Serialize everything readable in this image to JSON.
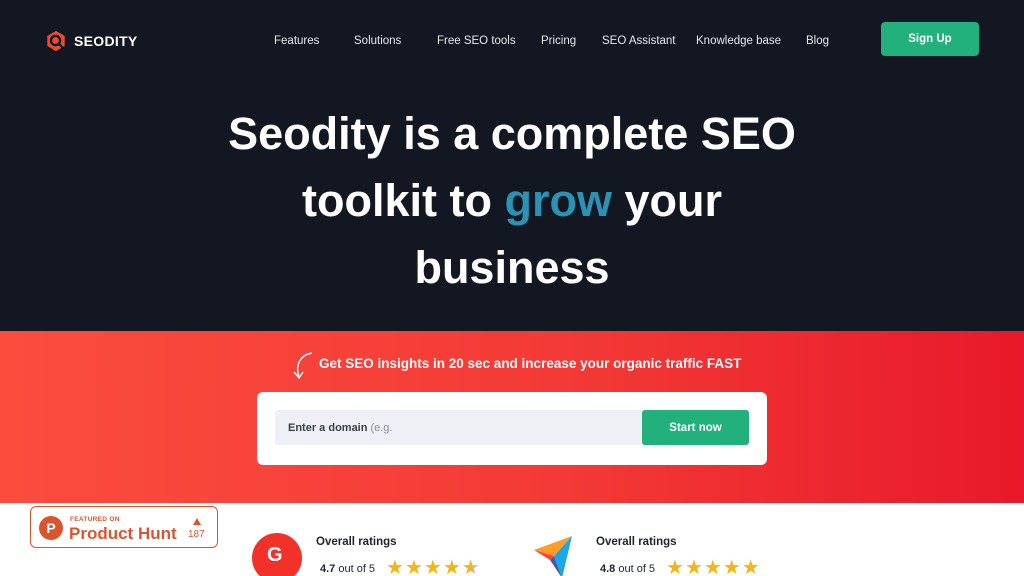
{
  "brand": {
    "name": "SEODITY",
    "logo_color": "#f04a2d"
  },
  "nav": {
    "items": [
      {
        "label": "Features"
      },
      {
        "label": "Solutions"
      },
      {
        "label": "Free SEO tools"
      },
      {
        "label": "Pricing"
      },
      {
        "label": "SEO Assistant"
      },
      {
        "label": "Knowledge base"
      },
      {
        "label": "Blog"
      }
    ],
    "signup_label": "Sign Up"
  },
  "hero": {
    "title_line1": "Seodity is a complete SEO",
    "title_line2_pre": "toolkit to ",
    "title_accent": "grow",
    "title_line2_post": " your",
    "title_line3": "business"
  },
  "cta": {
    "tagline": "Get SEO insights in 20 sec and increase your organic traffic FAST",
    "input_label": "Enter a domain",
    "input_hint": "(e.g.",
    "button_label": "Start now"
  },
  "product_hunt": {
    "featured_label": "FEATURED ON",
    "name": "Product Hunt",
    "votes": "187"
  },
  "ratings": [
    {
      "source_icon": "g2-logo-icon",
      "title": "Overall ratings",
      "score": "4.7",
      "suffix": "out of 5",
      "stars": 4.7
    },
    {
      "source_icon": "capterra-logo-icon",
      "title": "Overall ratings",
      "score": "4.8",
      "suffix": "out of 5",
      "stars": 4.8
    }
  ],
  "colors": {
    "background_dark": "#121722",
    "accent_teal": "#2a93b5",
    "button_green": "#22b07d",
    "band_red": "#f33a36",
    "star_gold": "#f3b617"
  }
}
